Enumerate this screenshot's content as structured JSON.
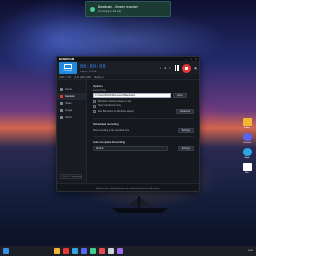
{
  "notification": {
    "title": "Bandicam - Screen recorder",
    "subtitle": "is running in the tray",
    "icon": "bandicam-icon"
  },
  "desktop_icons": [
    {
      "label": "Folder",
      "icon": "folder-icon",
      "color": "#f2b632"
    },
    {
      "label": "Discord",
      "icon": "discord-icon",
      "color": "#5865f2"
    },
    {
      "label": "Edge",
      "icon": "edge-icon",
      "color": "#2fa3e6"
    },
    {
      "label": "File",
      "icon": "file-icon",
      "color": "#ffffff"
    }
  ],
  "app": {
    "brand": "BANDICAM",
    "brand_tag": "",
    "window_controls": [
      "—",
      "□",
      "✕"
    ],
    "mode_label": "Rectangle",
    "timer": "00:00:00",
    "file_size": "0 bytes / 20.5GB",
    "subbar": [
      "1280 × 720",
      "(0,0) 1920 1080",
      "Display 1"
    ],
    "sidebar": [
      {
        "label": "Home",
        "active": false
      },
      {
        "label": "General",
        "active": true
      },
      {
        "label": "Video",
        "active": false
      },
      {
        "label": "Image",
        "active": false
      },
      {
        "label": "About",
        "active": false
      }
    ],
    "sidebar_bottom": "Ver. 7.0 · Registered",
    "content": {
      "title": "Options",
      "output_label": "Output folder",
      "output_path": "C:\\Users\\Dmitri\\Documents\\Bandicam",
      "browse_label": "Open",
      "checks": [
        "Bandicam window always on top",
        "Start minimized to tray",
        "Run Bandicam on Windows startup"
      ],
      "advanced_label": "Advanced",
      "scheduled_title": "Scheduled recording",
      "scheduled_text": "Start recording at the specified time",
      "settings_label": "Settings",
      "auto_title": "Auto Complete Recording",
      "auto_value": "Disable",
      "auto_settings_label": "Settings"
    },
    "footer": "Remove the 'www.Bandicam.com' watermark from the full version"
  },
  "taskbar": {
    "apps": [
      "#3a8ee6",
      "#f2b632",
      "#e53935",
      "#2fa3e6",
      "#5865f2",
      "#3ecf8e",
      "#e64b4b",
      "#d0d4da",
      "#9a6cf0"
    ],
    "time": "ENG"
  }
}
